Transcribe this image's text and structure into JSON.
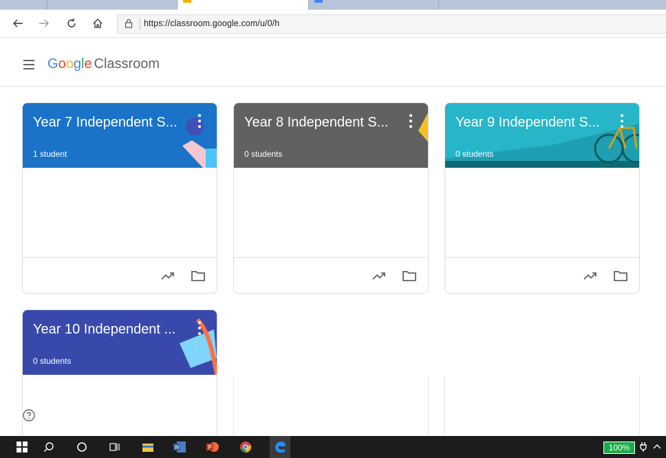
{
  "browser": {
    "url": "https://classroom.google.com/u/0/h"
  },
  "app": {
    "logo_google": "Google",
    "logo_product": "Classroom"
  },
  "classes": [
    {
      "title": "Year 7 Independent S...",
      "students": "1 student",
      "color": "#1a73c8"
    },
    {
      "title": "Year 8 Independent S...",
      "students": "0 students",
      "color": "#616161"
    },
    {
      "title": "Year 9 Independent S...",
      "students": "0 students",
      "color": "#26b5c9"
    },
    {
      "title": "Year 10 Independent ...",
      "students": "0 students",
      "color": "#3949ab"
    }
  ],
  "taskbar": {
    "battery": "100%"
  },
  "icons": {
    "card_footer": [
      "trending-up-icon",
      "folder-icon"
    ],
    "help": "help-icon"
  }
}
